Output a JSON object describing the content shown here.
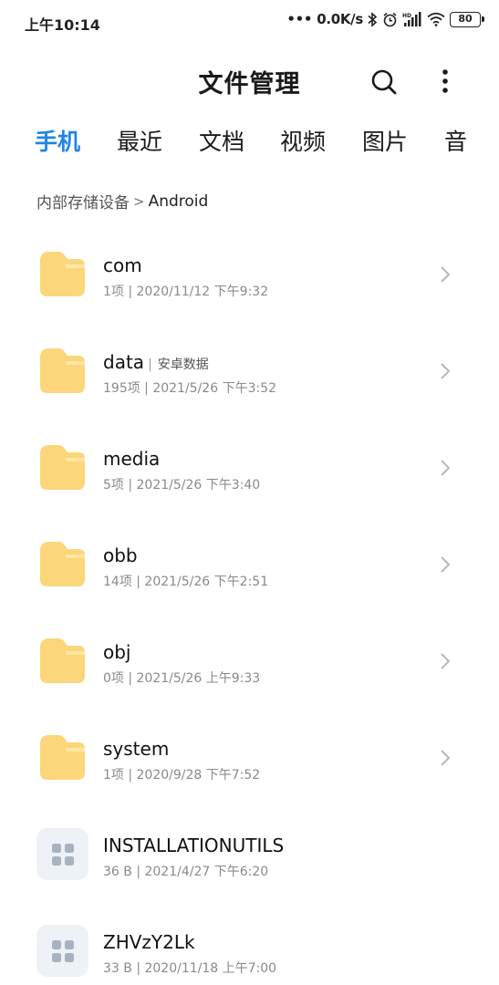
{
  "status_bar": {
    "time": "上午10:14",
    "dots": "•••",
    "network_speed": "0.0K/s",
    "icons": [
      "bluetooth-icon",
      "alarm-icon",
      "hd-signal-icon",
      "wifi-icon",
      "battery-icon"
    ],
    "battery": "80"
  },
  "header": {
    "title": "文件管理",
    "search_icon": "search-icon",
    "more_icon": "more-vertical-icon"
  },
  "tabs": [
    {
      "label": "手机",
      "active": true
    },
    {
      "label": "最近",
      "active": false
    },
    {
      "label": "文档",
      "active": false
    },
    {
      "label": "视频",
      "active": false
    },
    {
      "label": "图片",
      "active": false
    },
    {
      "label": "音",
      "active": false
    }
  ],
  "breadcrumb": {
    "root": "内部存储设备",
    "separator": ">",
    "current": "Android"
  },
  "files": [
    {
      "name": "com",
      "meta": "1项 | 2020/11/12 下午9:32",
      "type": "folder"
    },
    {
      "name": "data",
      "tag": "安卓数据",
      "meta": "195项 | 2021/5/26 下午3:52",
      "type": "folder"
    },
    {
      "name": "media",
      "meta": "5项 | 2021/5/26 下午3:40",
      "type": "folder"
    },
    {
      "name": "obb",
      "meta": "14项 | 2021/5/26 下午2:51",
      "type": "folder"
    },
    {
      "name": "obj",
      "meta": "0项 | 2021/5/26 上午9:33",
      "type": "folder"
    },
    {
      "name": "system",
      "meta": "1项 | 2020/9/28 下午7:52",
      "type": "folder"
    },
    {
      "name": "INSTALLATIONUTILS",
      "meta": "36 B | 2021/4/27 下午6:20",
      "type": "file"
    },
    {
      "name": "ZHVzY2Lk",
      "meta": "33 B | 2020/11/18 上午7:00",
      "type": "file"
    }
  ],
  "colors": {
    "accent": "#1f86e6",
    "folder": "#fbd67a",
    "folder_tab": "#fde7a6",
    "file_bg": "#eef1f5",
    "file_glyph": "#a9b2c1"
  }
}
